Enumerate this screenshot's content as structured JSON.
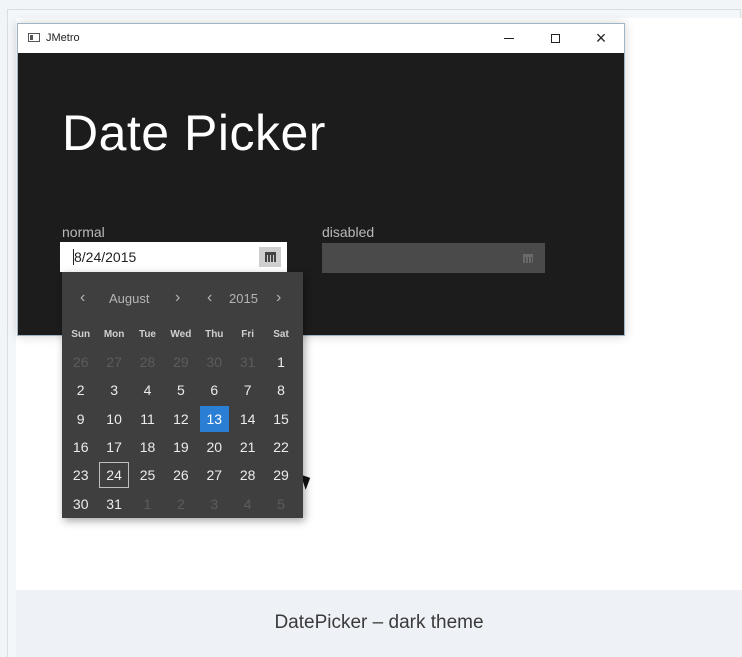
{
  "window": {
    "title": "JMetro",
    "controls": {
      "minimize": "minimize",
      "maximize": "maximize",
      "close": "×"
    }
  },
  "heading": "Date Picker",
  "normal": {
    "label": "normal",
    "value": "8/24/2015"
  },
  "disabled": {
    "label": "disabled",
    "value": ""
  },
  "calendar": {
    "prev_month": "‹",
    "month": "August",
    "next_month": "›",
    "prev_year": "‹",
    "year": "2015",
    "next_year": "›",
    "weekdays": [
      "Sun",
      "Mon",
      "Tue",
      "Wed",
      "Thu",
      "Fri",
      "Sat"
    ],
    "days": [
      {
        "label": "26",
        "state": "other"
      },
      {
        "label": "27",
        "state": "other"
      },
      {
        "label": "28",
        "state": "other"
      },
      {
        "label": "29",
        "state": "other"
      },
      {
        "label": "30",
        "state": "other"
      },
      {
        "label": "31",
        "state": "other"
      },
      {
        "label": "1",
        "state": ""
      },
      {
        "label": "2",
        "state": ""
      },
      {
        "label": "3",
        "state": ""
      },
      {
        "label": "4",
        "state": ""
      },
      {
        "label": "5",
        "state": ""
      },
      {
        "label": "6",
        "state": ""
      },
      {
        "label": "7",
        "state": ""
      },
      {
        "label": "8",
        "state": ""
      },
      {
        "label": "9",
        "state": ""
      },
      {
        "label": "10",
        "state": ""
      },
      {
        "label": "11",
        "state": ""
      },
      {
        "label": "12",
        "state": ""
      },
      {
        "label": "13",
        "state": "selected"
      },
      {
        "label": "14",
        "state": ""
      },
      {
        "label": "15",
        "state": ""
      },
      {
        "label": "16",
        "state": ""
      },
      {
        "label": "17",
        "state": ""
      },
      {
        "label": "18",
        "state": ""
      },
      {
        "label": "19",
        "state": ""
      },
      {
        "label": "20",
        "state": ""
      },
      {
        "label": "21",
        "state": ""
      },
      {
        "label": "22",
        "state": ""
      },
      {
        "label": "23",
        "state": ""
      },
      {
        "label": "24",
        "state": "today"
      },
      {
        "label": "25",
        "state": ""
      },
      {
        "label": "26",
        "state": ""
      },
      {
        "label": "27",
        "state": ""
      },
      {
        "label": "28",
        "state": ""
      },
      {
        "label": "29",
        "state": ""
      },
      {
        "label": "30",
        "state": ""
      },
      {
        "label": "31",
        "state": ""
      },
      {
        "label": "1",
        "state": "other"
      },
      {
        "label": "2",
        "state": "other"
      },
      {
        "label": "3",
        "state": "other"
      },
      {
        "label": "4",
        "state": "other"
      },
      {
        "label": "5",
        "state": "other"
      }
    ]
  },
  "caption": "DatePicker – dark theme",
  "colors": {
    "window_bg": "#1c1c1c",
    "popup_bg": "#3f3f3f",
    "selected": "#2a7fd4"
  }
}
